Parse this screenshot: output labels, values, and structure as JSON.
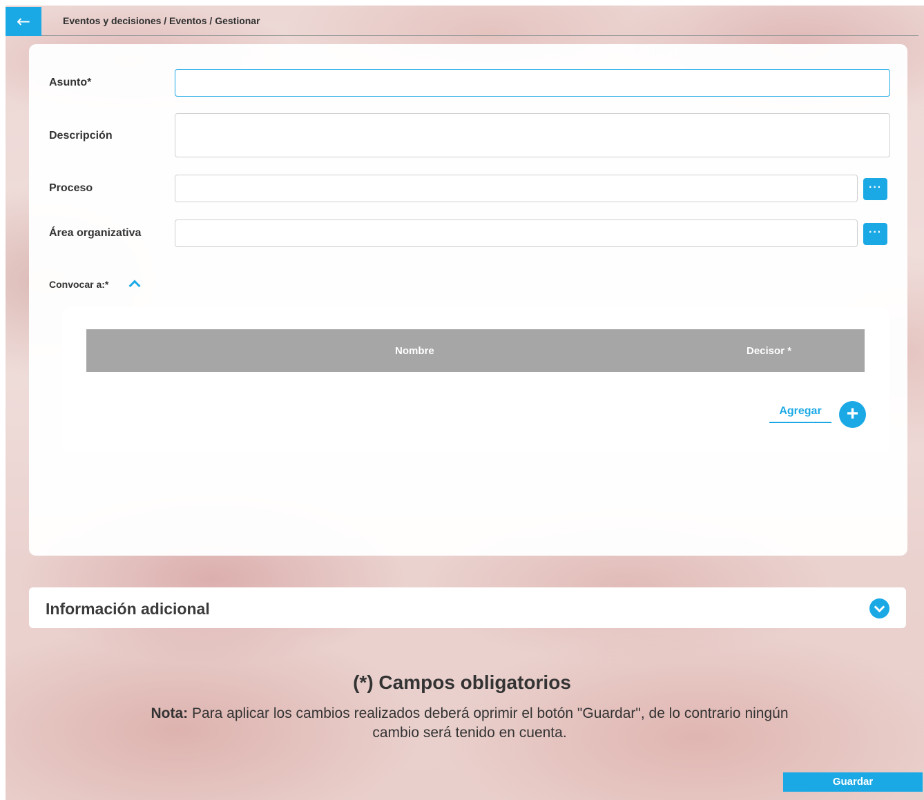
{
  "header": {
    "breadcrumb": "Eventos y decisiones / Eventos / Gestionar"
  },
  "form": {
    "asunto": {
      "label": "Asunto*",
      "value": ""
    },
    "descripcion": {
      "label": "Descripción",
      "value": ""
    },
    "proceso": {
      "label": "Proceso",
      "value": ""
    },
    "area": {
      "label": "Área organizativa",
      "value": ""
    },
    "lookup_button": "···"
  },
  "convocar": {
    "label": "Convocar a:*",
    "columns": [
      "Nombre",
      "Decisor *"
    ],
    "rows": [],
    "add_label": "Agregar",
    "add_symbol": "+"
  },
  "info_adicional": {
    "title": "Información adicional"
  },
  "footer": {
    "required_note": "(*) Campos obligatorios",
    "note_prefix": "Nota:",
    "note_text": " Para aplicar los cambios realizados deberá oprimir el botón \"Guardar\", de lo contrario ningún cambio será tenido en cuenta.",
    "save_label": "Guardar"
  },
  "colors": {
    "accent": "#1ba9e6",
    "table_header": "#a6a6a6"
  }
}
